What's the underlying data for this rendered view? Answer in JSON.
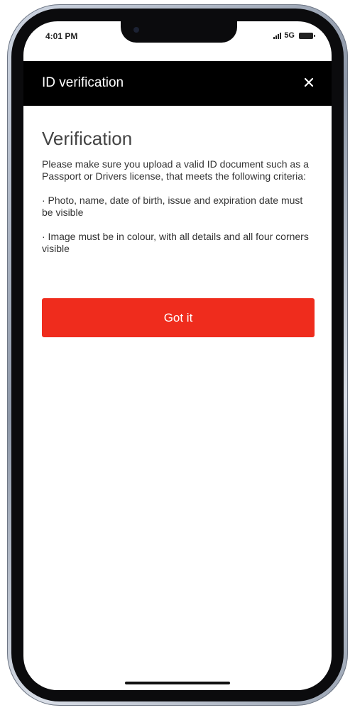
{
  "status_bar": {
    "time": "4:01 PM",
    "network": "5G"
  },
  "header": {
    "title": "ID verification",
    "close_icon": "close-icon"
  },
  "content": {
    "title": "Verification",
    "intro": "Please make sure you upload a valid ID document such as a Passport or Drivers license, that meets the following criteria:",
    "criteria": [
      "· Photo, name, date of birth, issue and expiration date must be visible",
      "· Image must be in colour, with all details and all four corners visible"
    ]
  },
  "cta": {
    "label": "Got it"
  },
  "colors": {
    "header_bg": "#000000",
    "cta_bg": "#ef2c1d",
    "cta_text": "#ffffff"
  }
}
